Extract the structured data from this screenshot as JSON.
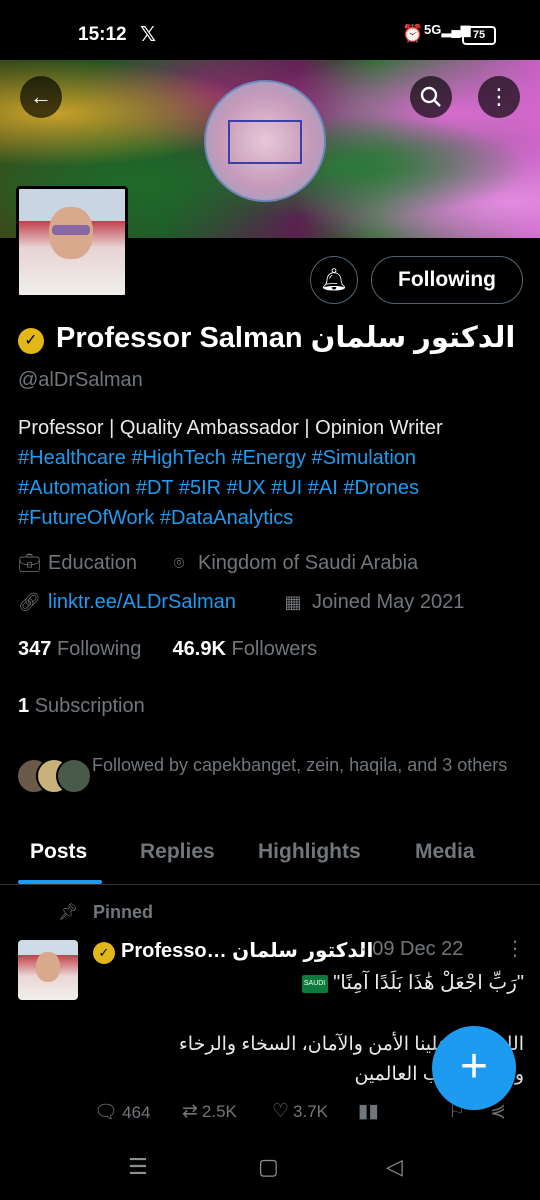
{
  "status_bar": {
    "time": "15:12",
    "app_icon": "x-logo",
    "network": "5G",
    "battery": "75"
  },
  "header": {
    "back_icon": "arrow-left-icon",
    "search_icon": "search-icon",
    "more_icon": "more-vertical-icon"
  },
  "profile": {
    "name": "Professor Salman الدكتور سلمان",
    "handle": "@alDrSalman",
    "bio_text": "Professor | Quality Ambassador | Opinion Writer",
    "bio_hashtags_line1": "#Healthcare #HighTech #Energy #Simulation",
    "bio_hashtags_line2": "#Automation #DT #5IR #UX #UI #AI #Drones",
    "bio_hashtags_line3": "#FutureOfWork #DataAnalytics",
    "category": "Education",
    "location": "Kingdom of Saudi Arabia",
    "link": "linktr.ee/ALDrSalman",
    "joined": "Joined May 2021",
    "following_count": "347",
    "following_label": "Following",
    "followers_count": "46.9K",
    "followers_label": "Followers",
    "subscription_count": "1",
    "subscription_label": "Subscription",
    "followed_by": "Followed by capekbanget, zein, haqila, and 3 others",
    "follow_button": "Following"
  },
  "tabs": [
    {
      "label": "Posts",
      "active": true
    },
    {
      "label": "Replies",
      "active": false
    },
    {
      "label": "Highlights",
      "active": false
    },
    {
      "label": "Media",
      "active": false
    }
  ],
  "pinned_post": {
    "pinned_label": "Pinned",
    "author": "Professo… الدكتور سلمان",
    "date": "· 09 Dec 22",
    "line1": "\"رَبِّ اجْعَلْ هَٰذَا بَلَدًا آمِنًا\"",
    "line2a": "اللهم أدم علينا الأمن والآمان، السخاء والرخاء",
    "line2b": "والنماء، يارب العالمين",
    "flag_text": "SAUDI",
    "replies": "464",
    "reposts": "2.5K",
    "likes": "3.7K"
  },
  "colors": {
    "accent": "#1d9bf0",
    "verified": "#e2b719",
    "muted": "#71767b",
    "background": "#000000"
  }
}
